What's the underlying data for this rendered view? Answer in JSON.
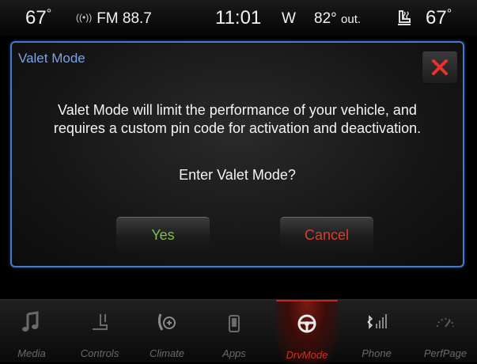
{
  "status_bar": {
    "left_temp": "67",
    "radio": "FM 88.7",
    "clock": "11:01",
    "compass": "W",
    "outside_temp": "82°",
    "outside_label": "out.",
    "right_temp": "67",
    "degree": "°"
  },
  "dialog": {
    "title": "Valet Mode",
    "message_line1": "Valet Mode will limit the performance of your vehicle, and",
    "message_line2": "requires a custom pin code for activation and deactivation.",
    "question": "Enter Valet Mode?",
    "yes_label": "Yes",
    "cancel_label": "Cancel",
    "close_icon": "close-x-icon"
  },
  "nav": {
    "items": [
      {
        "label": "Media",
        "icon": "music-note-icon"
      },
      {
        "label": "Controls",
        "icon": "seat-icon"
      },
      {
        "label": "Climate",
        "icon": "climate-icon"
      },
      {
        "label": "Apps",
        "icon": "apps-icon"
      },
      {
        "label": "DrvMode",
        "icon": "steering-wheel-icon"
      },
      {
        "label": "Phone",
        "icon": "phone-signal-icon"
      },
      {
        "label": "PerfPage",
        "icon": "gauge-icon"
      }
    ],
    "active": "DrvMode"
  },
  "colors": {
    "accent_blue": "#4a78c8",
    "yes_green": "#7ec04a",
    "cancel_red": "#e03a2c",
    "active_red": "#d8301f"
  }
}
